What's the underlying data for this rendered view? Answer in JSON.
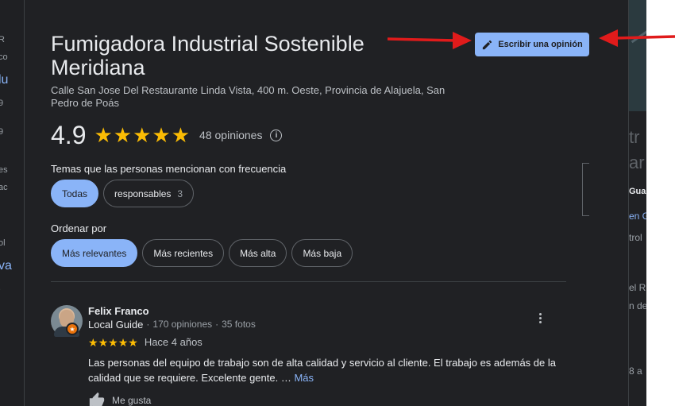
{
  "place": {
    "title": "Fumigadora Industrial Sostenible Meridiana",
    "address": "Calle San Jose Del Restaurante Linda Vista, 400 m. Oeste, Provincia de Alajuela, San Pedro de Poás"
  },
  "write_review": {
    "label": "Escribir una opinión",
    "icon": "pencil-icon"
  },
  "rating": {
    "value": "4.9",
    "stars": 5,
    "count_label": "48 opiniones",
    "info_icon": "info-icon"
  },
  "topics": {
    "label": "Temas que las personas mencionan con frecuencia",
    "chips": [
      {
        "label": "Todas",
        "count": "",
        "active": true
      },
      {
        "label": "responsables",
        "count": "3",
        "active": false
      }
    ]
  },
  "sort": {
    "label": "Ordenar por",
    "chips": [
      {
        "label": "Más relevantes",
        "active": true
      },
      {
        "label": "Más recientes",
        "active": false
      },
      {
        "label": "Más alta",
        "active": false
      },
      {
        "label": "Más baja",
        "active": false
      }
    ]
  },
  "review": {
    "author": "Felix Franco",
    "guide": "Local Guide",
    "reviews": "170 opiniones",
    "photos": "35 fotos",
    "separator": "·",
    "stars": 5,
    "date": "Hace 4 años",
    "text": "Las personas del equipo de trabajo son de alta calidad y servicio al cliente. El trabajo es además de la calidad que se requiere. Excelente gente. …",
    "more": "Más",
    "like": "Me gusta"
  },
  "colors": {
    "panel": "#202124",
    "accent": "#8ab4f8",
    "star": "#fbbc04",
    "arrow": "#e01b1b",
    "text": "#e8eaed"
  }
}
